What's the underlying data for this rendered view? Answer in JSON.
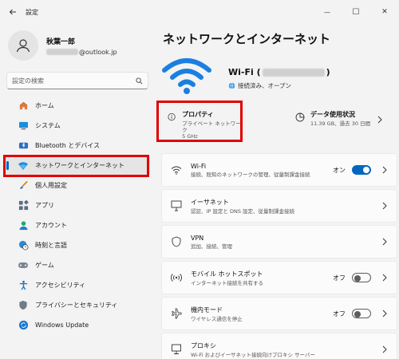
{
  "window": {
    "title": "設定",
    "minimize_glyph": "—",
    "maximize_glyph": "☐",
    "close_glyph": "✕"
  },
  "profile": {
    "name": "秋葉一郎",
    "email_suffix": "@outlook.jp"
  },
  "search": {
    "placeholder": "設定の検索"
  },
  "nav": {
    "items": [
      {
        "label": "ホーム",
        "icon": "home-icon"
      },
      {
        "label": "システム",
        "icon": "monitor-icon"
      },
      {
        "label": "Bluetooth とデバイス",
        "icon": "bluetooth-icon"
      },
      {
        "label": "ネットワークとインターネット",
        "icon": "network-icon",
        "active": true
      },
      {
        "label": "個人用設定",
        "icon": "brush-icon"
      },
      {
        "label": "アプリ",
        "icon": "apps-icon"
      },
      {
        "label": "アカウント",
        "icon": "account-icon"
      },
      {
        "label": "時刻と言語",
        "icon": "clock-globe-icon"
      },
      {
        "label": "ゲーム",
        "icon": "gamepad-icon"
      },
      {
        "label": "アクセシビリティ",
        "icon": "accessibility-icon"
      },
      {
        "label": "プライバシーとセキュリティ",
        "icon": "shield-icon"
      },
      {
        "label": "Windows Update",
        "icon": "update-icon"
      }
    ]
  },
  "main": {
    "title": "ネットワークとインターネット",
    "wifi": {
      "name_prefix": "Wi-Fi (",
      "name_suffix": ")",
      "status": "接続済み、オープン"
    },
    "properties": {
      "title": "プロパティ",
      "line1": "プライベート ネットワーク",
      "line2": "5 GHz"
    },
    "data_usage": {
      "title": "データ使用状況",
      "detail": "11.39 GB、過去 30 日間"
    },
    "rows": [
      {
        "title": "Wi-Fi",
        "desc": "接続、既知のネットワークの管理、従量制課金接続",
        "toggle": "オン",
        "icon": "wifi-icon"
      },
      {
        "title": "イーサネット",
        "desc": "認証、IP 設定と DNS 設定、従量制課金接続",
        "icon": "ethernet-icon"
      },
      {
        "title": "VPN",
        "desc": "追加、接続、管理",
        "icon": "vpn-shield-icon"
      },
      {
        "title": "モバイル ホットスポット",
        "desc": "インターネット接続を共有する",
        "toggle": "オフ",
        "icon": "hotspot-icon"
      },
      {
        "title": "機内モード",
        "desc": "ワイヤレス通信を停止",
        "toggle": "オフ",
        "icon": "airplane-icon"
      },
      {
        "title": "プロキシ",
        "desc": "Wi-Fi およびイーサネット接続向けプロキシ サーバー",
        "icon": "proxy-icon"
      }
    ]
  },
  "colors": {
    "accent": "#0067c0",
    "highlight_red": "#e00000"
  }
}
